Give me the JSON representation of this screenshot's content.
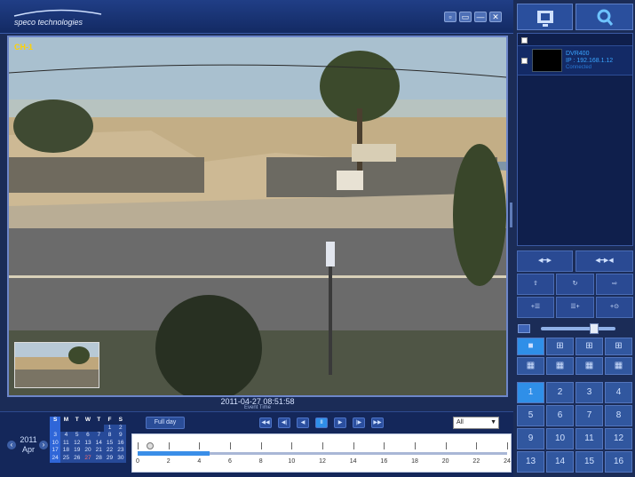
{
  "app": {
    "brand": "speco technologies",
    "window_controls": [
      "▫",
      "▭",
      "—",
      "✕"
    ]
  },
  "video": {
    "channel_label": "CH-1",
    "timestamp": "2011-04-27 08:51:58",
    "subtitle": "Event Time"
  },
  "right_panel": {
    "top_buttons": [
      {
        "icon": "display-icon"
      },
      {
        "icon": "search-icon"
      }
    ],
    "device": {
      "name": "DVR400",
      "ip": "IP : 192.168.1.12",
      "status": "Connected"
    },
    "ptz_top": [
      {
        "label": "◀━▶"
      },
      {
        "label": "◀━▶◀"
      }
    ],
    "ptz_rows": [
      [
        "⇧",
        "↻",
        "⇨"
      ],
      [
        "+☰",
        "☰+",
        "+⊙"
      ]
    ],
    "volume_level": 0.72,
    "layout_buttons": [
      "■",
      "⊞",
      "⊞",
      "⊞",
      "▦",
      "▦",
      "▦",
      "▦"
    ],
    "channel_buttons": [
      "1",
      "2",
      "3",
      "4",
      "5",
      "6",
      "7",
      "8",
      "9",
      "10",
      "11",
      "12",
      "13",
      "14",
      "15",
      "16"
    ]
  },
  "calendar": {
    "year": "2011",
    "month": "Apr",
    "headers": [
      "S",
      "M",
      "T",
      "W",
      "T",
      "F",
      "S"
    ],
    "weeks": [
      [
        "",
        "",
        "",
        "",
        "",
        "1",
        "2"
      ],
      [
        "3",
        "4",
        "5",
        "6",
        "7",
        "8",
        "9"
      ],
      [
        "10",
        "11",
        "12",
        "13",
        "14",
        "15",
        "16"
      ],
      [
        "17",
        "18",
        "19",
        "20",
        "21",
        "22",
        "23"
      ],
      [
        "24",
        "25",
        "26",
        "27",
        "28",
        "29",
        "30"
      ]
    ],
    "today": "27"
  },
  "playback": {
    "full_day_label": "Full day",
    "buttons": [
      "◀◀",
      "◀|",
      "◀",
      "II",
      "▶",
      "|▶",
      "▶▶"
    ],
    "active_button": 3,
    "channel_select": "All"
  },
  "timeline": {
    "labels": [
      "0",
      "2",
      "4",
      "6",
      "8",
      "10",
      "12",
      "14",
      "16",
      "18",
      "20",
      "22",
      "24"
    ],
    "recorded_until_hour": 4.7,
    "marker_hour": 0.8
  }
}
